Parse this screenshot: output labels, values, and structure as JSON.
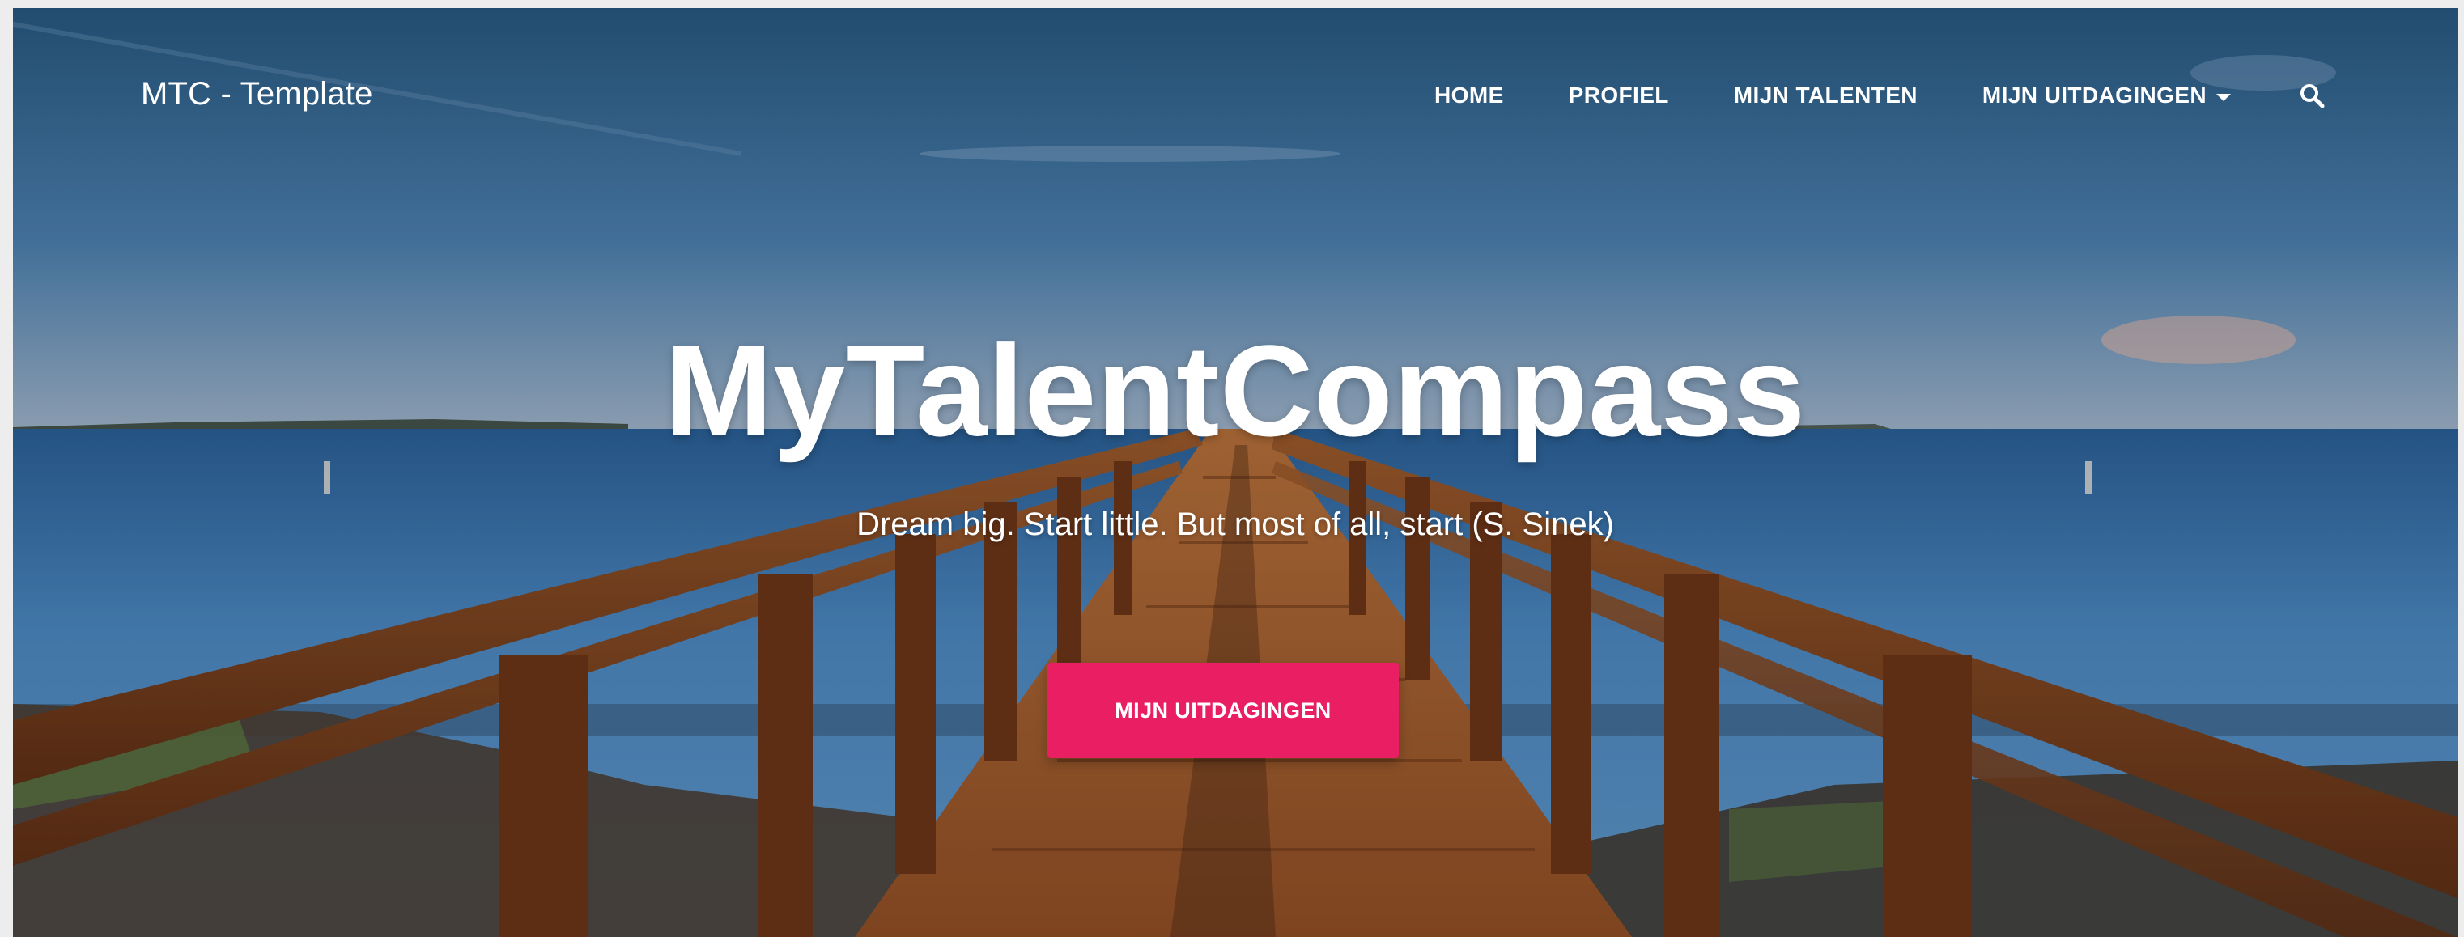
{
  "brand": {
    "label": "MTC - Template"
  },
  "nav": {
    "items": [
      {
        "label": "HOME"
      },
      {
        "label": "PROFIEL"
      },
      {
        "label": "MIJN TALENTEN"
      },
      {
        "label": "MIJN UITDAGINGEN"
      }
    ],
    "search_icon": "search-icon",
    "dropdown_icon": "caret-down-icon"
  },
  "hero": {
    "title": "MyTalentCompass",
    "subtitle": "Dream big. Start little. But most of all, start (S. Sinek)",
    "cta_label": "MIJN UITDAGINGEN",
    "background": "photo of wooden pier leading over a lake under blue sky"
  },
  "colors": {
    "accent": "#e91e63",
    "text": "#ffffff",
    "sky": "#2f5f8e",
    "water": "#3f7bb4",
    "wood": "#8a4a22"
  }
}
